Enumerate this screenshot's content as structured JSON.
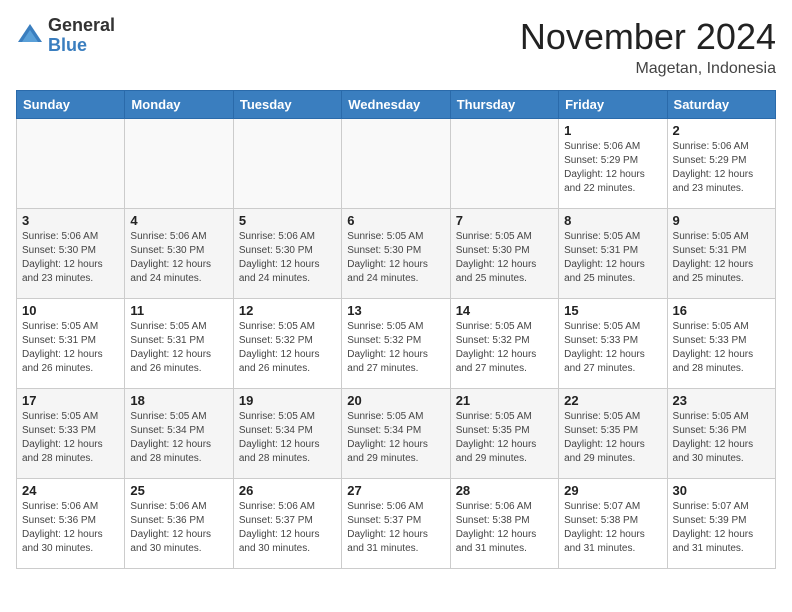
{
  "logo": {
    "general": "General",
    "blue": "Blue"
  },
  "header": {
    "month": "November 2024",
    "location": "Magetan, Indonesia"
  },
  "weekdays": [
    "Sunday",
    "Monday",
    "Tuesday",
    "Wednesday",
    "Thursday",
    "Friday",
    "Saturday"
  ],
  "weeks": [
    [
      {
        "day": "",
        "info": ""
      },
      {
        "day": "",
        "info": ""
      },
      {
        "day": "",
        "info": ""
      },
      {
        "day": "",
        "info": ""
      },
      {
        "day": "",
        "info": ""
      },
      {
        "day": "1",
        "info": "Sunrise: 5:06 AM\nSunset: 5:29 PM\nDaylight: 12 hours\nand 22 minutes."
      },
      {
        "day": "2",
        "info": "Sunrise: 5:06 AM\nSunset: 5:29 PM\nDaylight: 12 hours\nand 23 minutes."
      }
    ],
    [
      {
        "day": "3",
        "info": "Sunrise: 5:06 AM\nSunset: 5:30 PM\nDaylight: 12 hours\nand 23 minutes."
      },
      {
        "day": "4",
        "info": "Sunrise: 5:06 AM\nSunset: 5:30 PM\nDaylight: 12 hours\nand 24 minutes."
      },
      {
        "day": "5",
        "info": "Sunrise: 5:06 AM\nSunset: 5:30 PM\nDaylight: 12 hours\nand 24 minutes."
      },
      {
        "day": "6",
        "info": "Sunrise: 5:05 AM\nSunset: 5:30 PM\nDaylight: 12 hours\nand 24 minutes."
      },
      {
        "day": "7",
        "info": "Sunrise: 5:05 AM\nSunset: 5:30 PM\nDaylight: 12 hours\nand 25 minutes."
      },
      {
        "day": "8",
        "info": "Sunrise: 5:05 AM\nSunset: 5:31 PM\nDaylight: 12 hours\nand 25 minutes."
      },
      {
        "day": "9",
        "info": "Sunrise: 5:05 AM\nSunset: 5:31 PM\nDaylight: 12 hours\nand 25 minutes."
      }
    ],
    [
      {
        "day": "10",
        "info": "Sunrise: 5:05 AM\nSunset: 5:31 PM\nDaylight: 12 hours\nand 26 minutes."
      },
      {
        "day": "11",
        "info": "Sunrise: 5:05 AM\nSunset: 5:31 PM\nDaylight: 12 hours\nand 26 minutes."
      },
      {
        "day": "12",
        "info": "Sunrise: 5:05 AM\nSunset: 5:32 PM\nDaylight: 12 hours\nand 26 minutes."
      },
      {
        "day": "13",
        "info": "Sunrise: 5:05 AM\nSunset: 5:32 PM\nDaylight: 12 hours\nand 27 minutes."
      },
      {
        "day": "14",
        "info": "Sunrise: 5:05 AM\nSunset: 5:32 PM\nDaylight: 12 hours\nand 27 minutes."
      },
      {
        "day": "15",
        "info": "Sunrise: 5:05 AM\nSunset: 5:33 PM\nDaylight: 12 hours\nand 27 minutes."
      },
      {
        "day": "16",
        "info": "Sunrise: 5:05 AM\nSunset: 5:33 PM\nDaylight: 12 hours\nand 28 minutes."
      }
    ],
    [
      {
        "day": "17",
        "info": "Sunrise: 5:05 AM\nSunset: 5:33 PM\nDaylight: 12 hours\nand 28 minutes."
      },
      {
        "day": "18",
        "info": "Sunrise: 5:05 AM\nSunset: 5:34 PM\nDaylight: 12 hours\nand 28 minutes."
      },
      {
        "day": "19",
        "info": "Sunrise: 5:05 AM\nSunset: 5:34 PM\nDaylight: 12 hours\nand 28 minutes."
      },
      {
        "day": "20",
        "info": "Sunrise: 5:05 AM\nSunset: 5:34 PM\nDaylight: 12 hours\nand 29 minutes."
      },
      {
        "day": "21",
        "info": "Sunrise: 5:05 AM\nSunset: 5:35 PM\nDaylight: 12 hours\nand 29 minutes."
      },
      {
        "day": "22",
        "info": "Sunrise: 5:05 AM\nSunset: 5:35 PM\nDaylight: 12 hours\nand 29 minutes."
      },
      {
        "day": "23",
        "info": "Sunrise: 5:05 AM\nSunset: 5:36 PM\nDaylight: 12 hours\nand 30 minutes."
      }
    ],
    [
      {
        "day": "24",
        "info": "Sunrise: 5:06 AM\nSunset: 5:36 PM\nDaylight: 12 hours\nand 30 minutes."
      },
      {
        "day": "25",
        "info": "Sunrise: 5:06 AM\nSunset: 5:36 PM\nDaylight: 12 hours\nand 30 minutes."
      },
      {
        "day": "26",
        "info": "Sunrise: 5:06 AM\nSunset: 5:37 PM\nDaylight: 12 hours\nand 30 minutes."
      },
      {
        "day": "27",
        "info": "Sunrise: 5:06 AM\nSunset: 5:37 PM\nDaylight: 12 hours\nand 31 minutes."
      },
      {
        "day": "28",
        "info": "Sunrise: 5:06 AM\nSunset: 5:38 PM\nDaylight: 12 hours\nand 31 minutes."
      },
      {
        "day": "29",
        "info": "Sunrise: 5:07 AM\nSunset: 5:38 PM\nDaylight: 12 hours\nand 31 minutes."
      },
      {
        "day": "30",
        "info": "Sunrise: 5:07 AM\nSunset: 5:39 PM\nDaylight: 12 hours\nand 31 minutes."
      }
    ]
  ]
}
